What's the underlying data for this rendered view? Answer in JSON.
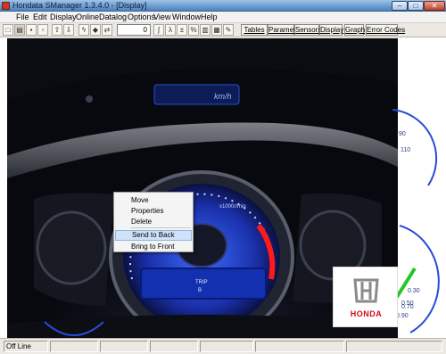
{
  "window": {
    "title": "Hondata SManager 1.3.4.0 - [Display]",
    "min_glyph": "–",
    "max_glyph": "□",
    "close_glyph": "✕"
  },
  "menu": [
    "File",
    "Edit",
    "Display",
    "Online",
    "Datalog",
    "Options",
    "View",
    "Window",
    "Help"
  ],
  "toolbar": {
    "field_value": "0",
    "tabs": [
      "Tables",
      "Parameters",
      "Sensors",
      "Display",
      "Graph",
      "Error Codes"
    ]
  },
  "dashboard": {
    "speed_unit": "km/h",
    "rpm_label": "x1000r/min",
    "trip_label": "TRIP",
    "trip_sub": "B",
    "brand": "HONDA",
    "side_gauge_top": [
      "90",
      "110"
    ],
    "side_gauge_bottom": [
      "0.30",
      "0.50",
      "0.70",
      "0.90"
    ]
  },
  "context_menu": {
    "items": [
      "Move",
      "Properties",
      "Delete",
      "Send to Back",
      "Bring to Front"
    ],
    "highlighted": "Send to Back"
  },
  "status": {
    "state": "Off Line"
  },
  "colors": {
    "accent_green": "#1e8a1e",
    "gauge_blue": "#2a4bd8",
    "brand_red": "#d10a16"
  }
}
